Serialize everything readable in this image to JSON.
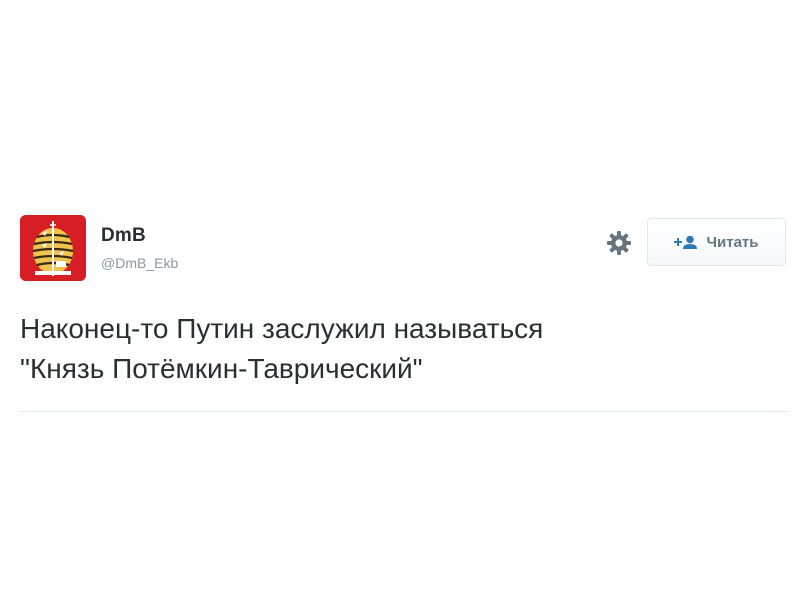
{
  "user": {
    "name": "DmB",
    "handle": "@DmB_Ekb",
    "avatar_icon": "beehive-icon",
    "avatar_color": "#d81e25"
  },
  "follow_button": {
    "label": "Читать",
    "icon": "add-user-icon"
  },
  "settings": {
    "icon": "gear-icon"
  },
  "tweet": {
    "text": "Наконец-то Путин заслужил называться\n\"Князь Потёмкин-Таврический\""
  }
}
